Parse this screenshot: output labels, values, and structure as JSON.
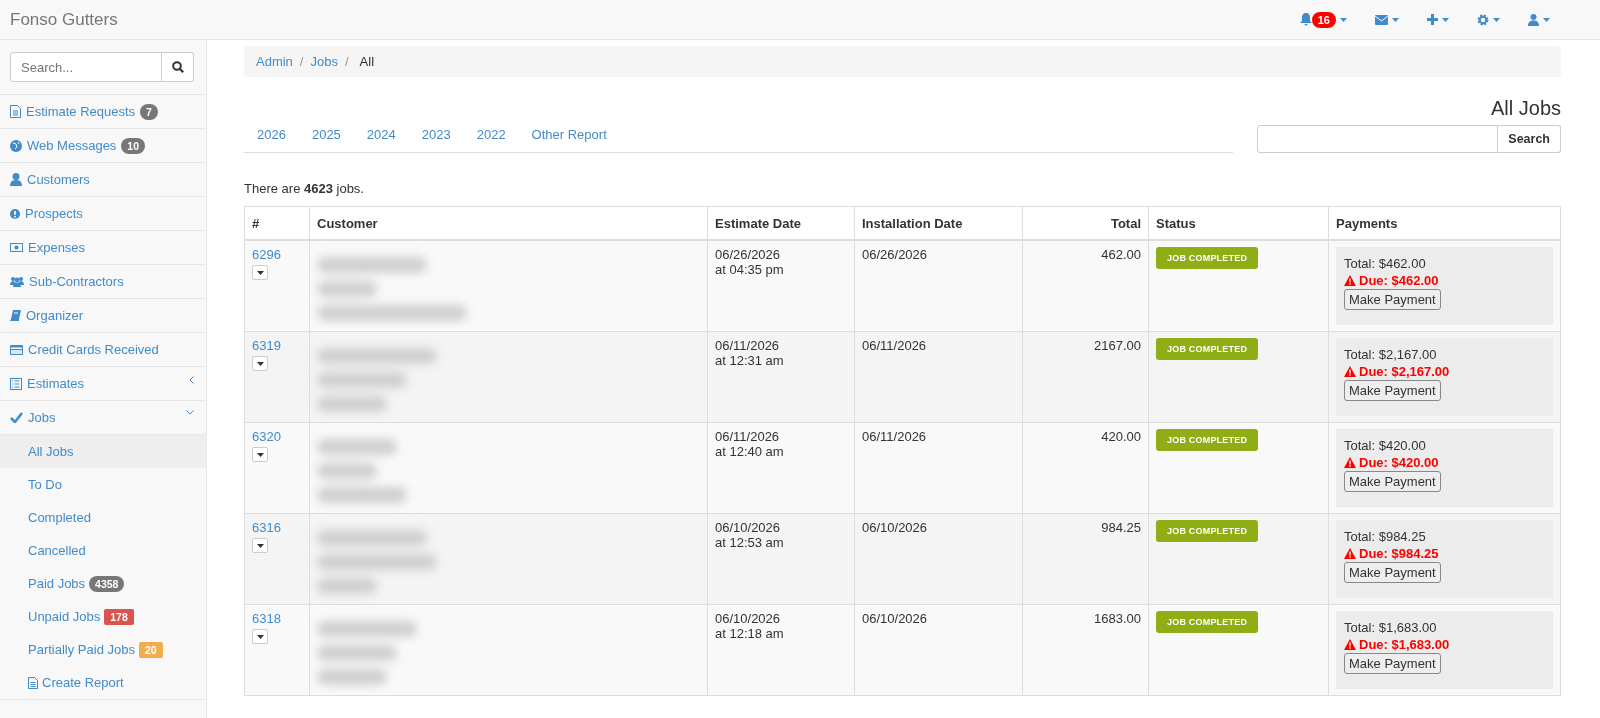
{
  "brand": "Fonso Gutters",
  "navbar": [
    {
      "kind": "bell",
      "badge": "16"
    },
    {
      "kind": "envelope"
    },
    {
      "kind": "plus"
    },
    {
      "kind": "gear"
    },
    {
      "kind": "user"
    }
  ],
  "sidebar": {
    "search": {
      "placeholder": "Search..."
    },
    "items": [
      {
        "label": "Estimate Requests",
        "badge": {
          "text": "7",
          "color": "#777777"
        }
      },
      {
        "label": "Web Messages",
        "badge": {
          "text": "10",
          "color": "#777777"
        }
      },
      {
        "label": "Customers"
      },
      {
        "label": "Prospects"
      },
      {
        "label": "Expenses"
      },
      {
        "label": "Sub-Contractors"
      },
      {
        "label": "Organizer"
      },
      {
        "label": "Credit Cards Received"
      },
      {
        "label": "Estimates",
        "expanded": false
      },
      {
        "label": "Jobs",
        "expanded": true,
        "children": [
          {
            "label": "All Jobs",
            "selected": true
          },
          {
            "label": "To Do",
            "selected": false
          },
          {
            "label": "Completed",
            "selected": false
          },
          {
            "label": "Cancelled",
            "selected": false
          },
          {
            "label": "Paid Jobs",
            "selected": false,
            "badge": {
              "text": "4358",
              "color": "#777777"
            }
          },
          {
            "label": "Unpaid Jobs",
            "selected": false,
            "badge": {
              "text": "178",
              "color": "#d9534f"
            }
          },
          {
            "label": "Partially Paid Jobs",
            "selected": false,
            "badge": {
              "text": "20",
              "color": "#f0ad4e"
            }
          },
          {
            "label": "Create Report",
            "selected": false,
            "kind": "report"
          }
        ]
      }
    ]
  },
  "breadcrumb": {
    "separator": "/",
    "items": [
      {
        "label": "Admin",
        "link": true
      },
      {
        "label": "Jobs",
        "link": true
      },
      {
        "label": "All",
        "link": false
      }
    ]
  },
  "title": "All Jobs",
  "search": {
    "button": "Search"
  },
  "year_tabs": [
    "2026",
    "2025",
    "2024",
    "2023",
    "2022",
    "Other Report"
  ],
  "count_text": "There are **4623** jobs.",
  "table": {
    "columns": [
      "#",
      "Customer",
      "Estimate Date",
      "Installation Date",
      "Total",
      "Status",
      "Payments"
    ],
    "rows": [
      {
        "id": "6296",
        "estimate_date": "06/26/2026",
        "estimate_time": "at 04:35 pm",
        "installation_date": "06/26/2026",
        "total": "462.00",
        "status": "JOB COMPLETED",
        "payment_total": "Total: $462.00",
        "payment_due": "Due: $462.00",
        "payment_button": "Make Payment"
      },
      {
        "id": "6319",
        "estimate_date": "06/11/2026",
        "estimate_time": "at 12:31 am",
        "installation_date": "06/11/2026",
        "total": "2167.00",
        "status": "JOB COMPLETED",
        "payment_total": "Total: $2,167.00",
        "payment_due": "Due: $2,167.00",
        "payment_button": "Make Payment"
      },
      {
        "id": "6320",
        "estimate_date": "06/11/2026",
        "estimate_time": "at 12:40 am",
        "installation_date": "06/11/2026",
        "total": "420.00",
        "status": "JOB COMPLETED",
        "payment_total": "Total: $420.00",
        "payment_due": "Due: $420.00",
        "payment_button": "Make Payment"
      },
      {
        "id": "6316",
        "estimate_date": "06/10/2026",
        "estimate_time": "at 12:53 am",
        "installation_date": "06/10/2026",
        "total": "984.25",
        "status": "JOB COMPLETED",
        "payment_total": "Total: $984.25",
        "payment_due": "Due: $984.25",
        "payment_button": "Make Payment"
      },
      {
        "id": "6318",
        "estimate_date": "06/10/2026",
        "estimate_time": "at 12:18 am",
        "installation_date": "06/10/2026",
        "total": "1683.00",
        "status": "JOB COMPLETED",
        "payment_total": "Total: $1,683.00",
        "payment_due": "Due: $1,683.00",
        "payment_button": "Make Payment"
      }
    ]
  }
}
